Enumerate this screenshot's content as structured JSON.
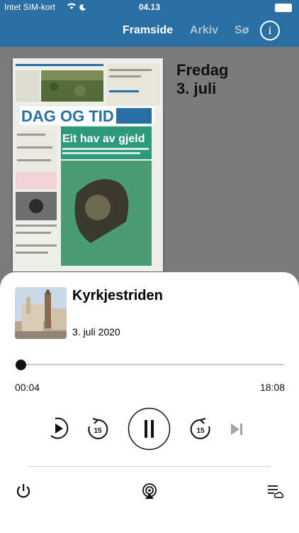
{
  "status": {
    "carrier": "Intet SIM-kort",
    "time": "04.13"
  },
  "nav": {
    "tabs": [
      {
        "label": "Framside"
      },
      {
        "label": "Arkiv"
      },
      {
        "label": "Sø"
      }
    ]
  },
  "issue": {
    "weekday": "Fredag",
    "date": "3. juli"
  },
  "cover": {
    "masthead": "DAG OG TID",
    "headline": "Eit hav av gjeld"
  },
  "player": {
    "title": "Kyrkjestriden",
    "date": "3. juli 2020",
    "elapsed": "00:04",
    "total": "18:08",
    "progress": 0.004,
    "skip_back_seconds": "15",
    "skip_forward_seconds": "15"
  }
}
